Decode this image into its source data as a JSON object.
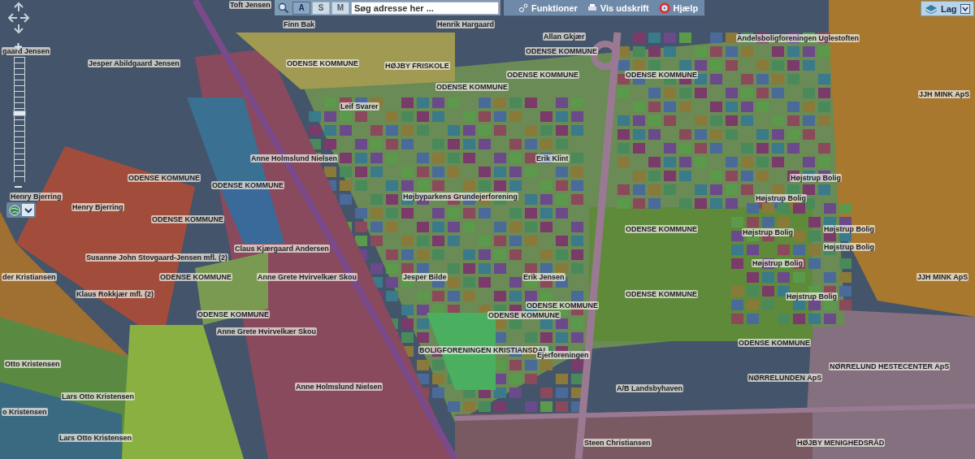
{
  "toolbar": {
    "search_buttons": [
      {
        "label": "A",
        "selected": true
      },
      {
        "label": "S",
        "selected": false
      },
      {
        "label": "M",
        "selected": false
      }
    ],
    "search": {
      "placeholder": "Søg adresse her ..."
    },
    "menu": [
      "Funktioner",
      "Vis udskrift",
      "Hjælp"
    ]
  },
  "layer_button": {
    "label": "Lag"
  },
  "zoom_slider": {
    "level": 0.55
  },
  "map_labels": [
    "Toft Jensen",
    "Finn Bak",
    "Henrik Hargaard",
    "Allan Gkjær",
    "Andelsboligforeningen Uglestoften",
    "gaard Jensen",
    "ODENSE KOMMUNE",
    "Jesper Abildgaard Jensen",
    "ODENSE KOMMUNE",
    "HØJBY FRISKOLE",
    "ODENSE KOMMUNE",
    "ODENSE KOMMUNE",
    "ODENSE KOMMUNE",
    "JJH MINK ApS",
    "Leif Svarer",
    "Anne Holmslund Nielsen",
    "Erik Klint",
    "ODENSE KOMMUNE",
    "Højstrup Bolig",
    "ODENSE KOMMUNE",
    "Henry Bjerring",
    "Højbyparkens Grundejerforening",
    "Højstrup Bolig",
    "Henry Bjerring",
    "ODENSE KOMMUNE",
    "ODENSE KOMMUNE",
    "Højstrup Bolig",
    "Højstrup Bolig",
    "Claus Kjærgaard Andersen",
    "Højstrup Bolig",
    "Susanne John Stovgaard-Jensen mfl. (2)",
    "Højstrup Bolig",
    "der Kristiansen",
    "ODENSE KOMMUNE",
    "Anne Grete Hvirvelkær Skou",
    "Jesper Bilde",
    "Erik Jensen",
    "JJH MINK ApS",
    "Klaus Rokkjær mfl. (2)",
    "ODENSE KOMMUNE",
    "Højstrup Bolig",
    "ODENSE KOMMUNE",
    "ODENSE KOMMUNE",
    "ODENSE KOMMUNE",
    "Anne Grete Hvirvelkær Skou",
    "ODENSE KOMMUNE",
    "BOLIGFORENINGEN KRISTIANSDAL",
    "Ejerforeningen",
    "Otto Kristensen",
    "NØRRELUND HESTECENTER ApS",
    "NØRRELUNDEN ApS",
    "Anne Holmslund Nielsen",
    "A/B Landsbyhaven",
    "Lars Otto Kristensen",
    "o Kristensen",
    "Lars Otto Kristensen",
    "Steen Christiansen",
    "HØJBY MENIGHEDSRÅD"
  ]
}
